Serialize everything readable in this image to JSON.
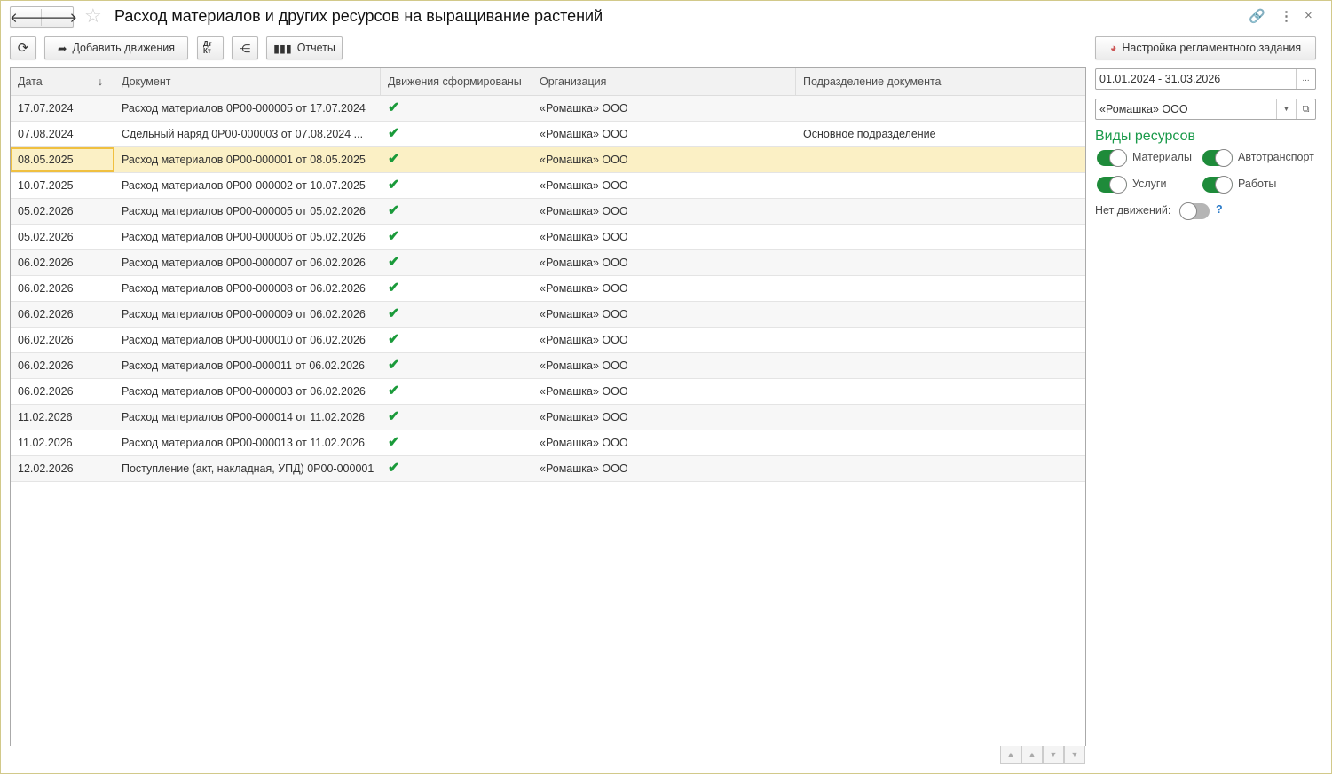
{
  "title": "Расход материалов и других ресурсов на выращивание растений",
  "toolbar": {
    "add_movements": "Добавить движения",
    "reports": "Отчеты",
    "dtkt": "Дт Кт"
  },
  "columns": [
    "Дата",
    "Документ",
    "Движения сформированы",
    "Организация",
    "Подразделение документа"
  ],
  "rows": [
    {
      "date": "17.07.2024",
      "doc": "Расход материалов 0Р00-000005 от 17.07.2024",
      "done": "✔",
      "org": "«Ромашка» ООО",
      "dept": ""
    },
    {
      "date": "07.08.2024",
      "doc": "Сдельный наряд 0Р00-000003 от 07.08.2024 ...",
      "done": "✔",
      "org": "«Ромашка» ООО",
      "dept": "Основное подразделение"
    },
    {
      "date": "08.05.2025",
      "doc": "Расход материалов 0Р00-000001 от 08.05.2025",
      "done": "✔",
      "org": "«Ромашка» ООО",
      "dept": ""
    },
    {
      "date": "10.07.2025",
      "doc": "Расход материалов 0Р00-000002 от 10.07.2025",
      "done": "✔",
      "org": "«Ромашка» ООО",
      "dept": ""
    },
    {
      "date": "05.02.2026",
      "doc": "Расход материалов 0Р00-000005 от 05.02.2026",
      "done": "✔",
      "org": "«Ромашка» ООО",
      "dept": ""
    },
    {
      "date": "05.02.2026",
      "doc": "Расход материалов 0Р00-000006 от 05.02.2026",
      "done": "✔",
      "org": "«Ромашка» ООО",
      "dept": ""
    },
    {
      "date": "06.02.2026",
      "doc": "Расход материалов 0Р00-000007 от 06.02.2026",
      "done": "✔",
      "org": "«Ромашка» ООО",
      "dept": ""
    },
    {
      "date": "06.02.2026",
      "doc": "Расход материалов 0Р00-000008 от 06.02.2026",
      "done": "✔",
      "org": "«Ромашка» ООО",
      "dept": ""
    },
    {
      "date": "06.02.2026",
      "doc": "Расход материалов 0Р00-000009 от 06.02.2026",
      "done": "✔",
      "org": "«Ромашка» ООО",
      "dept": ""
    },
    {
      "date": "06.02.2026",
      "doc": "Расход материалов 0Р00-000010 от 06.02.2026",
      "done": "✔",
      "org": "«Ромашка» ООО",
      "dept": ""
    },
    {
      "date": "06.02.2026",
      "doc": "Расход материалов 0Р00-000011 от 06.02.2026",
      "done": "✔",
      "org": "«Ромашка» ООО",
      "dept": ""
    },
    {
      "date": "06.02.2026",
      "doc": "Расход материалов 0Р00-000003 от 06.02.2026",
      "done": "✔",
      "org": "«Ромашка» ООО",
      "dept": ""
    },
    {
      "date": "11.02.2026",
      "doc": "Расход материалов 0Р00-000014 от 11.02.2026",
      "done": "✔",
      "org": "«Ромашка» ООО",
      "dept": ""
    },
    {
      "date": "11.02.2026",
      "doc": "Расход материалов 0Р00-000013 от 11.02.2026",
      "done": "✔",
      "org": "«Ромашка» ООО",
      "dept": ""
    },
    {
      "date": "12.02.2026",
      "doc": "Поступление (акт, накладная, УПД) 0Р00-000001",
      "done": "✔",
      "org": "«Ромашка» ООО",
      "dept": ""
    }
  ],
  "side": {
    "schedule_btn": "Настройка регламентного задания",
    "period": "01.01.2024 - 31.03.2026",
    "org": "«Ромашка» ООО",
    "resources_title": "Виды ресурсов",
    "toggles": [
      {
        "label": "Материалы",
        "on": true
      },
      {
        "label": "Автотранспорт",
        "on": true
      },
      {
        "label": "Услуги",
        "on": true
      },
      {
        "label": "Работы",
        "on": true
      }
    ],
    "no_movements": "Нет движений:",
    "no_movements_on": false,
    "help": "?",
    "dots": "..."
  },
  "colors": {
    "accent": "#1e8b3a",
    "selected": "#fbf0c5"
  }
}
